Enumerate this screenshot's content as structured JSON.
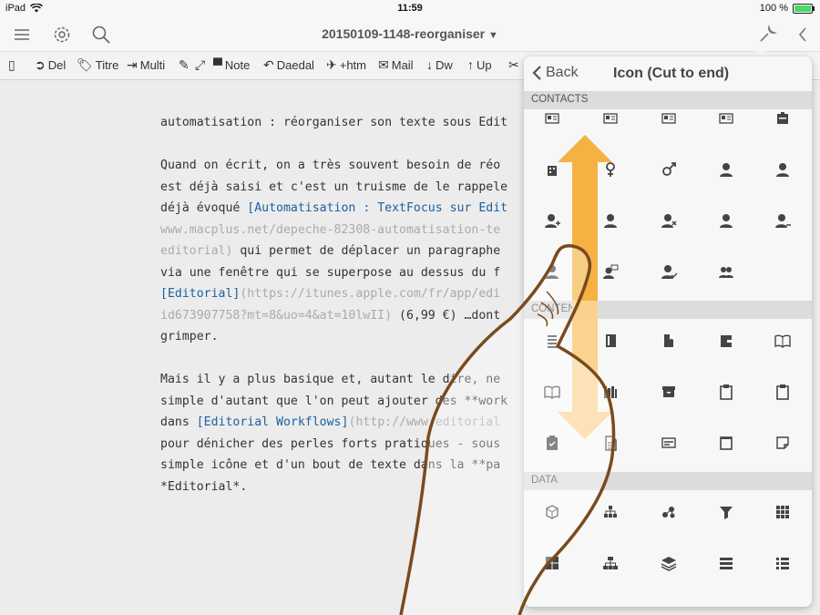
{
  "status": {
    "device": "iPad",
    "time": "11:59",
    "battery": "100 %"
  },
  "nav": {
    "title": "20150109-1148-reorganiser"
  },
  "toolbar": {
    "items": [
      {
        "label": "Del"
      },
      {
        "label": "Titre"
      },
      {
        "label": "Multi"
      },
      {
        "label": "Note"
      },
      {
        "label": "Daedal"
      },
      {
        "label": "+htm"
      },
      {
        "label": "Mail"
      },
      {
        "label": "Dw"
      },
      {
        "label": "Up"
      }
    ]
  },
  "editor": {
    "l1": "automatisation : réorganiser son texte sous Edit",
    "l2": "Quand on écrit, on a très souvent besoin de réo",
    "l3": "est déjà saisi et c'est un truisme de le rappele",
    "l4a": "déjà évoqué ",
    "l4b": "[Automatisation : TextFocus sur Edit",
    "l5": "www.macplus.net/depeche-82308-automatisation-te",
    "l6a": "editorial)",
    "l6b": " qui permet de déplacer un paragraphe",
    "l7": "via une fenêtre qui se superpose au dessus du f",
    "l8a": "[Editorial]",
    "l8b": "(https://itunes.apple.com/fr/app/edi",
    "l9a": "id673907758?mt=8&uo=4&at=10lwII)",
    "l9b": " (6,99 €) …dont",
    "l10": "grimper.",
    "l11": "Mais il y a plus basique et, autant le dire, ne",
    "l12": "simple d'autant que l'on peut ajouter des **work",
    "l13a": "dans ",
    "l13b": "[Editorial Workflows]",
    "l13c": "(http://www.editorial",
    "l14": "pour dénicher des perles forts pratiques - sous",
    "l15": "simple icône et d'un bout de texte dans la **pa",
    "l16": "*Editorial*."
  },
  "popover": {
    "back_label": "Back",
    "title": "Icon (Cut to end)",
    "sections": [
      "CONTACTS",
      "CONTENT",
      "DATA"
    ]
  },
  "icons": {
    "contacts": [
      "id-card-icon",
      "id-card-icon",
      "id-card-icon",
      "id-card-icon",
      "badge-icon",
      "building-icon",
      "female-icon",
      "male-icon",
      "user-icon",
      "user-icon",
      "user-add-icon",
      "user-icon",
      "user-remove-icon",
      "user-icon",
      "user-minus-icon",
      "user-icon",
      "user-comment-icon",
      "user-check-icon",
      "users-icon"
    ],
    "content": [
      "list-icon",
      "notebook-icon",
      "bookmark-icon",
      "wallet-icon",
      "open-book-icon",
      "open-book-icon",
      "library-icon",
      "archive-icon",
      "clipboard-icon",
      "clipboard-icon",
      "clipboard-check-icon",
      "document-icon",
      "card-icon",
      "frame-icon",
      "sticky-note-icon"
    ],
    "data": [
      "cube-icon",
      "hierarchy-icon",
      "network-icon",
      "filter-icon",
      "grid-icon",
      "grid-large-icon",
      "sitemap-icon",
      "layers-icon",
      "list-rows-icon",
      "list-bullets-icon"
    ]
  }
}
